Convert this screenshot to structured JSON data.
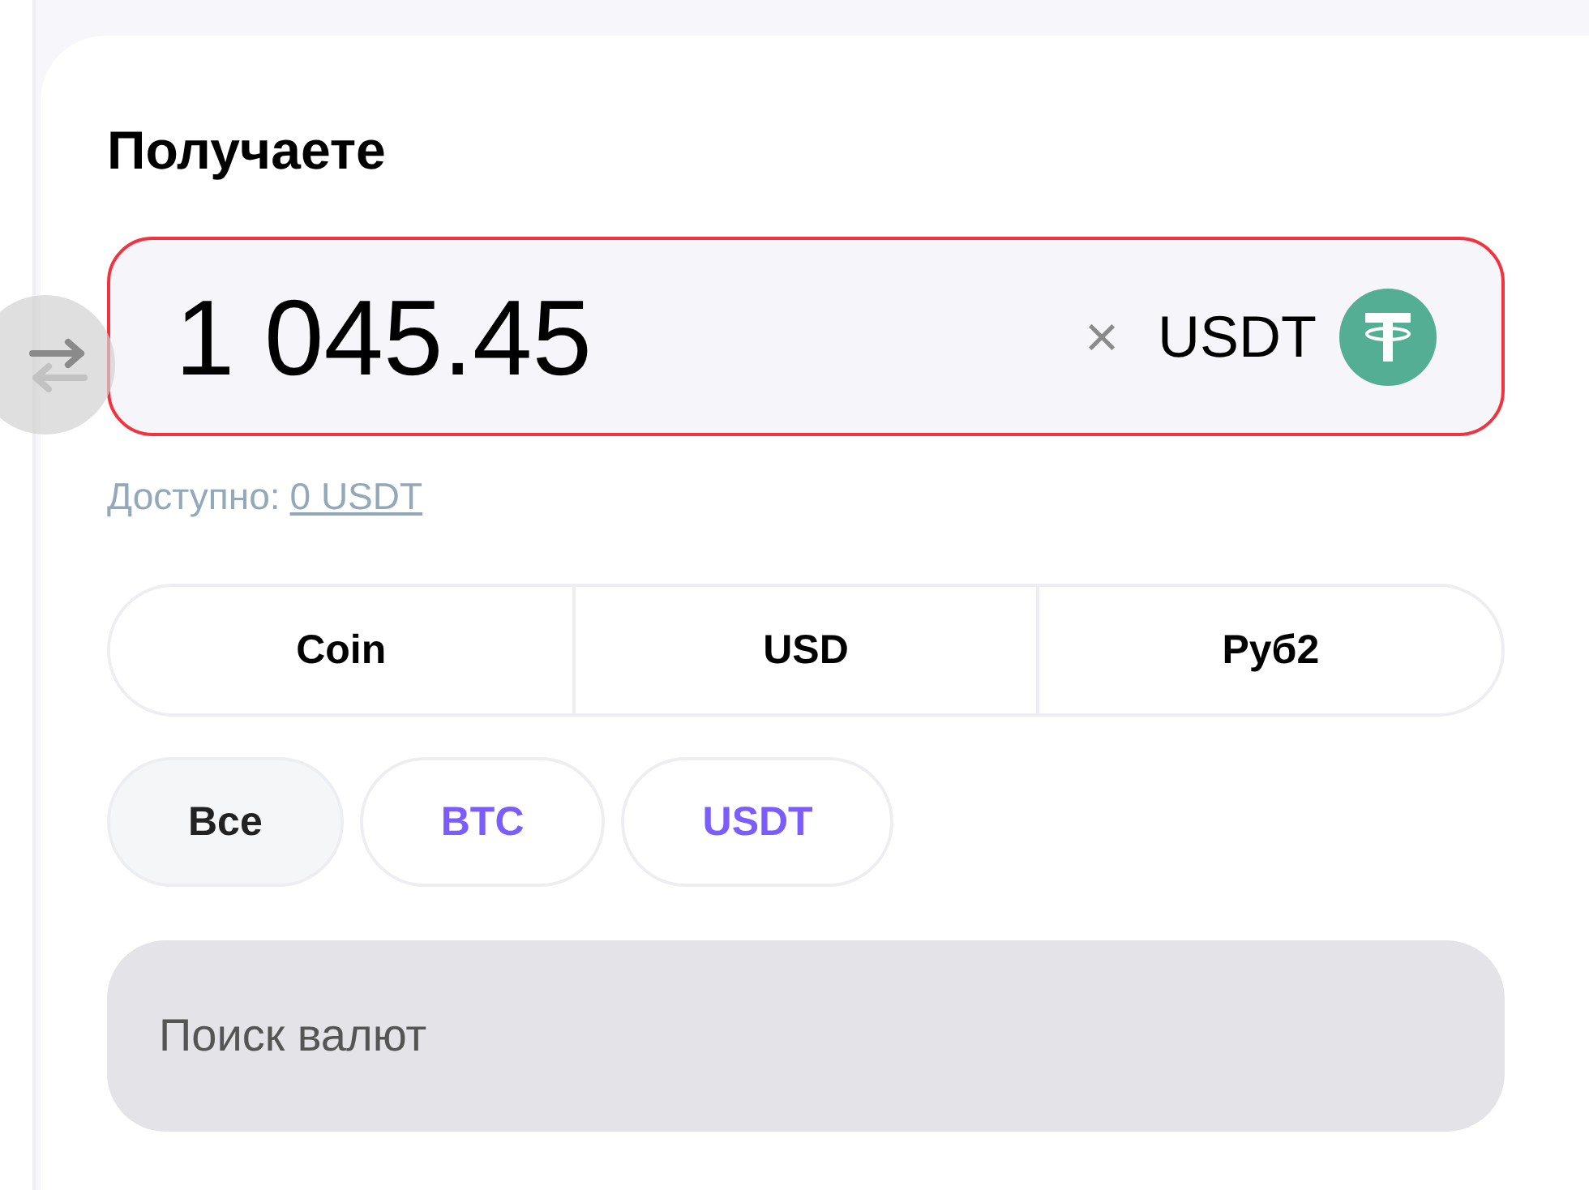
{
  "title": "Получаете",
  "amount": {
    "value": "1 045.45",
    "currency": "USDT",
    "clear": "×",
    "invalid": true
  },
  "available": {
    "label": "Доступно:",
    "link": "0 USDT"
  },
  "segments": [
    {
      "label": "Coin"
    },
    {
      "label": "USD"
    },
    {
      "label": "Руб2"
    }
  ],
  "chips": [
    {
      "label": "Все",
      "selected": true
    },
    {
      "label": "BTC",
      "selected": false
    },
    {
      "label": "USDT",
      "selected": false
    }
  ],
  "search": {
    "placeholder": "Поиск валют"
  }
}
